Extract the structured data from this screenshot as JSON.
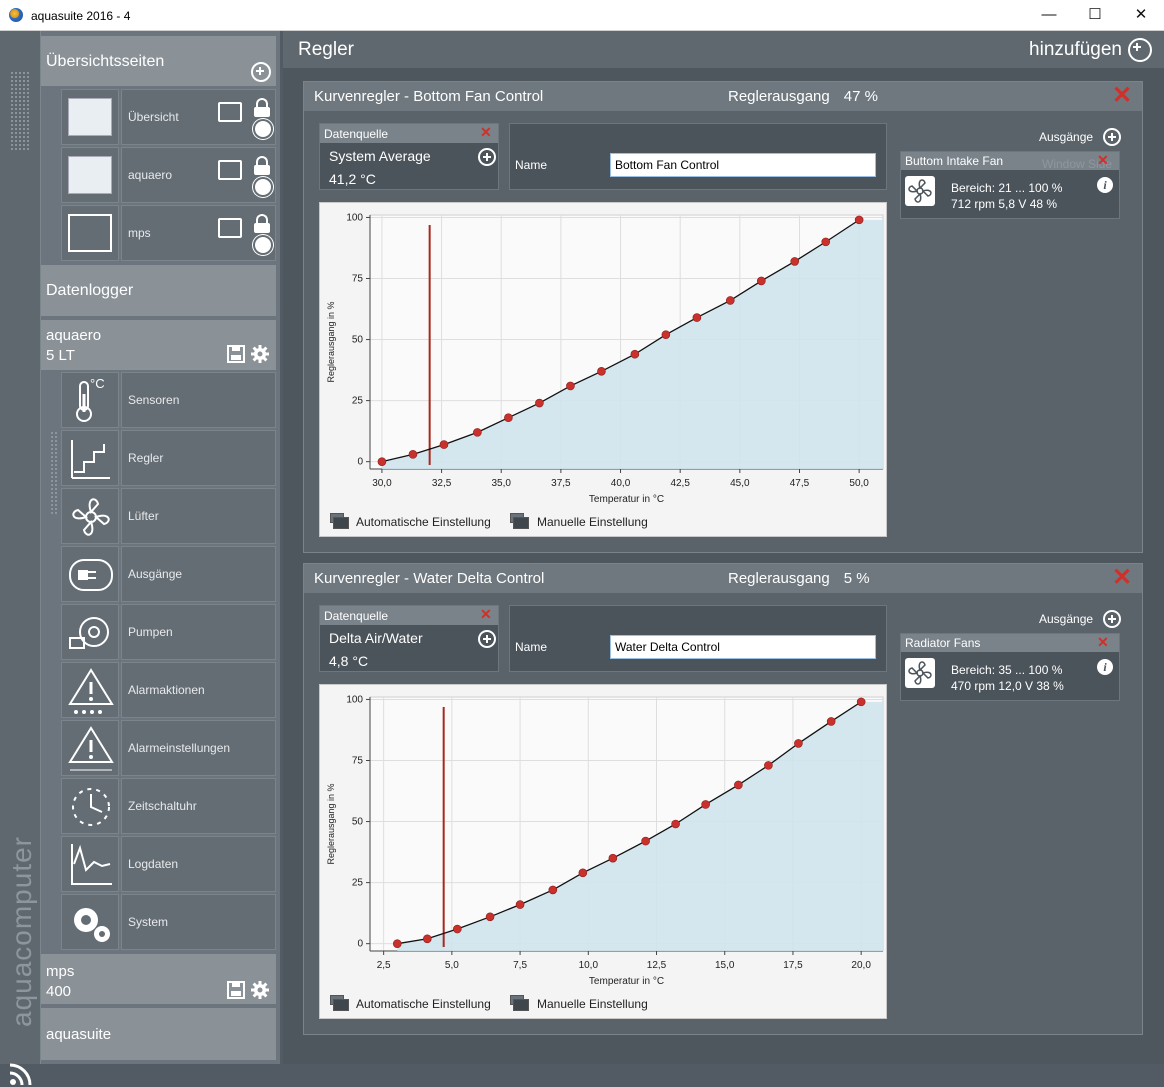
{
  "window": {
    "title": "aquasuite 2016 - 4",
    "minimize": "—",
    "maximize": "☐",
    "close": "✕"
  },
  "brand": "aquacomputer",
  "sidebar": {
    "overview": {
      "label": "Übersichtsseiten",
      "pages": [
        "Übersicht",
        "aquaero",
        "mps"
      ]
    },
    "datalogger": "Datenlogger",
    "device1": {
      "line1": "aquaero",
      "line2": "5 LT",
      "items": [
        "Sensoren",
        "Regler",
        "Lüfter",
        "Ausgänge",
        "Pumpen",
        "Alarmaktionen",
        "Alarmeinstellungen",
        "Zeitschaltuhr",
        "Logdaten",
        "System"
      ]
    },
    "device2": {
      "line1": "mps",
      "line2": "400"
    },
    "aquasuite": "aquasuite",
    "celsius_glyph": "°C"
  },
  "main": {
    "title": "Regler",
    "add_label": "hinzufügen"
  },
  "panels": [
    {
      "title": "Kurvenregler  -  Bottom Fan Control",
      "output_label": "Reglerausgang",
      "output_value": "47 %",
      "source_header": "Datenquelle",
      "source_name": "System Average",
      "source_value": "41,2 °C",
      "name_label": "Name",
      "name_value": "Bottom Fan Control",
      "outputs_label": "Ausgänge",
      "output_card": {
        "name": "Buttom Intake Fan",
        "line1": "Bereich:  21 ... 100  %",
        "line2": "712 rpm  5,8 V  48 %",
        "ghost": "Window Side"
      },
      "btn_auto": "Automatische Einstellung",
      "btn_manual": "Manuelle Einstellung"
    },
    {
      "title": "Kurvenregler  -  Water Delta Control",
      "output_label": "Reglerausgang",
      "output_value": "5 %",
      "source_header": "Datenquelle",
      "source_name": "Delta Air/Water",
      "source_value": "4,8 °C",
      "name_label": "Name",
      "name_value": "Water Delta Control",
      "outputs_label": "Ausgänge",
      "output_card": {
        "name": "Radiator Fans",
        "line1": "Bereich:  35 ... 100  %",
        "line2": "470 rpm  12,0 V  38 %",
        "ghost": ""
      },
      "btn_auto": "Automatische Einstellung",
      "btn_manual": "Manuelle Einstellung"
    }
  ],
  "chart_data": [
    {
      "type": "line",
      "xlabel": "Temperatur in °C",
      "ylabel": "Reglerausgang in %",
      "xlim": [
        29.5,
        51
      ],
      "ylim": [
        -3,
        101
      ],
      "xticks": [
        30.0,
        32.5,
        35.0,
        37.5,
        40.0,
        42.5,
        45.0,
        47.5,
        50.0
      ],
      "xtick_labels": [
        "30,0",
        "32,5",
        "35,0",
        "37,5",
        "40,0",
        "42,5",
        "45,0",
        "47,5",
        "50,0"
      ],
      "yticks": [
        0,
        25,
        50,
        75,
        100
      ],
      "ytick_labels": [
        "0",
        "25",
        "50",
        "75",
        "100"
      ],
      "current_x": 32.0,
      "grid": true,
      "x": [
        30.0,
        31.3,
        32.6,
        34.0,
        35.3,
        36.6,
        37.9,
        39.2,
        40.6,
        41.9,
        43.2,
        44.6,
        45.9,
        47.3,
        48.6,
        50.0
      ],
      "y": [
        0,
        3,
        7,
        12,
        18,
        24,
        31,
        37,
        44,
        52,
        59,
        66,
        74,
        82,
        90,
        99
      ]
    },
    {
      "type": "line",
      "xlabel": "Temperatur in °C",
      "ylabel": "Reglerausgang in %",
      "xlim": [
        2.0,
        20.8
      ],
      "ylim": [
        -3,
        101
      ],
      "xticks": [
        2.5,
        5.0,
        7.5,
        10.0,
        12.5,
        15.0,
        17.5,
        20.0
      ],
      "xtick_labels": [
        "2,5",
        "5,0",
        "7,5",
        "10,0",
        "12,5",
        "15,0",
        "17,5",
        "20,0"
      ],
      "yticks": [
        0,
        25,
        50,
        75,
        100
      ],
      "ytick_labels": [
        "0",
        "25",
        "50",
        "75",
        "100"
      ],
      "current_x": 4.7,
      "grid": true,
      "x": [
        3.0,
        4.1,
        5.2,
        6.4,
        7.5,
        8.7,
        9.8,
        10.9,
        12.1,
        13.2,
        14.3,
        15.5,
        16.6,
        17.7,
        18.9,
        20.0
      ],
      "y": [
        0,
        2,
        6,
        11,
        16,
        22,
        29,
        35,
        42,
        49,
        57,
        65,
        73,
        82,
        91,
        99
      ]
    }
  ]
}
